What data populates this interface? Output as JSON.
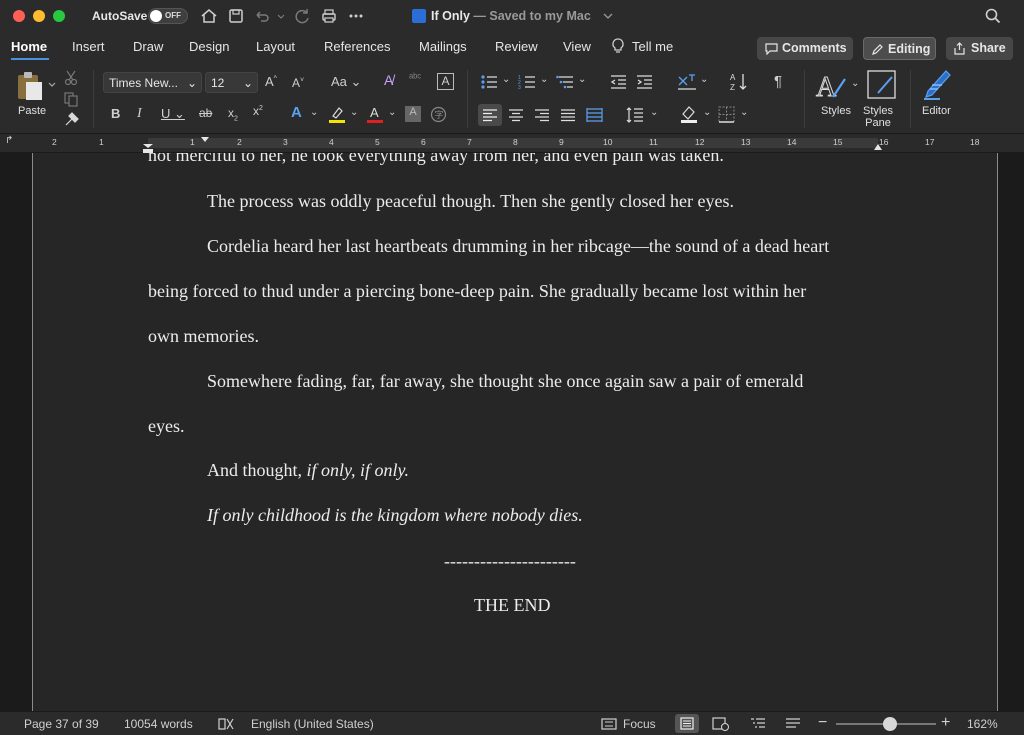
{
  "titlebar": {
    "autosave_label": "AutoSave",
    "autosave_state": "OFF",
    "doc_name": "If Only",
    "doc_status": "— Saved to my Mac"
  },
  "tabs": {
    "items": [
      "Home",
      "Insert",
      "Draw",
      "Design",
      "Layout",
      "References",
      "Mailings",
      "Review",
      "View"
    ],
    "tell_me": "Tell me",
    "comments": "Comments",
    "editing": "Editing",
    "share": "Share"
  },
  "ribbon": {
    "paste": "Paste",
    "font_name": "Times New...",
    "font_size": "12",
    "styles": "Styles",
    "styles_pane_1": "Styles",
    "styles_pane_2": "Pane",
    "editor": "Editor"
  },
  "ruler": {
    "numbers": [
      "2",
      "1",
      "1",
      "2",
      "3",
      "4",
      "5",
      "6",
      "7",
      "8",
      "9",
      "10",
      "11",
      "12",
      "13",
      "14",
      "15",
      "16",
      "17",
      "18"
    ]
  },
  "document": {
    "line_cut": "not merciful to her, he took everything away from her, and even pain was taken.",
    "p1": "The process was oddly peaceful though. Then she gently closed her eyes.",
    "p2_l1": "Cordelia heard her last heartbeats drumming in her ribcage—the sound of a dead heart",
    "p2_l2": "being forced to thud under a piercing bone-deep pain. She gradually became lost within her",
    "p2_l3": "own memories.",
    "p3_l1": "Somewhere fading, far, far away, she thought she once again saw a pair of emerald",
    "p3_l2": "eyes.",
    "p4_plain": "And thought, ",
    "p4_italic": "if only, if only.",
    "p5": "If only childhood is the kingdom where nobody dies.",
    "divider": "----------------------",
    "the_end": "THE END"
  },
  "statusbar": {
    "page": "Page 37 of 39",
    "words": "10054 words",
    "language": "English (United States)",
    "focus": "Focus",
    "zoom": "162%",
    "zoom_level_percent": 162
  }
}
